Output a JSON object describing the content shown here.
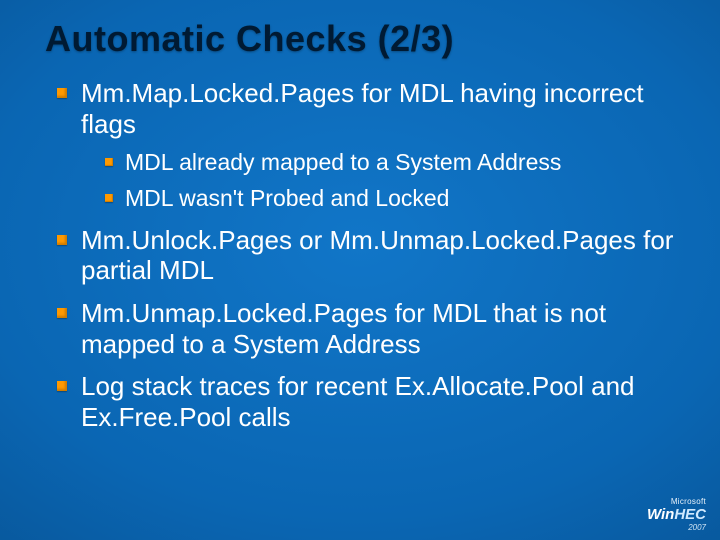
{
  "title": "Automatic Checks (2/3)",
  "bullets": [
    {
      "text": "Mm.Map.Locked.Pages for MDL having incorrect flags",
      "children": [
        {
          "text": "MDL already mapped to a System Address"
        },
        {
          "text": "MDL wasn't Probed and Locked"
        }
      ]
    },
    {
      "text": "Mm.Unlock.Pages or Mm.Unmap.Locked.Pages for partial MDL"
    },
    {
      "text": "Mm.Unmap.Locked.Pages for MDL that is not mapped to a System Address"
    },
    {
      "text": "Log stack traces for recent Ex.Allocate.Pool and Ex.Free.Pool calls"
    }
  ],
  "footer": {
    "company": "Microsoft",
    "brand_a": "Win",
    "brand_b": "HEC",
    "year": "2007"
  }
}
